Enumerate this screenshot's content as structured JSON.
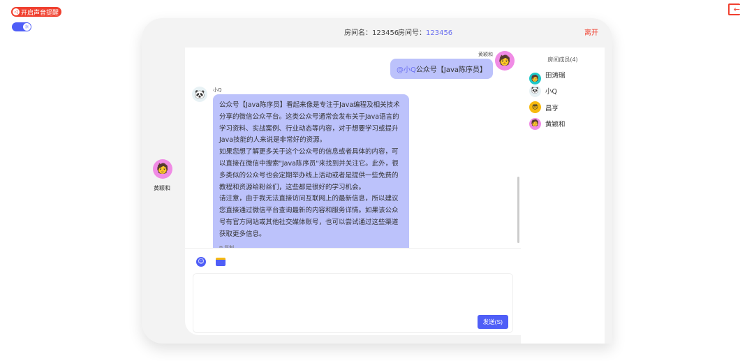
{
  "top": {
    "sound_label": "开启声音提醒",
    "sound_icon": "speaker-icon",
    "toggle_icon": "sun-icon",
    "exit_icon": "exit-icon"
  },
  "header": {
    "room_name_label": "房间名：",
    "room_name": "123456",
    "room_id_label": "房间号：",
    "room_id": "123456",
    "leave": "离开"
  },
  "current_user": {
    "name": "黄颖和"
  },
  "messages": [
    {
      "sender": "黄颖和",
      "mention": "@小Q",
      "text": "公众号【Java陈序员】"
    },
    {
      "sender": "小Q",
      "paragraphs": [
        "公众号【Java陈序员】看起来像是专注于Java编程及相关技术分享的微信公众平台。这类公众号通常会发布关于Java语言的学习资料、实战案例、行业动态等内容，对于想要学习或提升Java技能的人来说是非常好的资源。",
        "如果您想了解更多关于这个公众号的信息或者具体的内容，可以直接在微信中搜索\"Java陈序员\"来找到并关注它。此外，很多类似的公众号也会定期举办线上活动或者是提供一些免费的教程和资源给粉丝们，这些都是很好的学习机会。",
        "请注意，由于我无法直接访问互联网上的最新信息，所以建议您直接通过微信平台查询最新的内容和服务详情。如果该公众号有官方网站或其他社交媒体账号，也可以尝试通过这些渠道获取更多信息。"
      ],
      "copy": "复制"
    }
  ],
  "composer": {
    "send": "发送(S)",
    "input_value": ""
  },
  "members": {
    "title": "房间成员(4)",
    "list": [
      {
        "name": "田涛瑞"
      },
      {
        "name": "小Q"
      },
      {
        "name": "昌亨"
      },
      {
        "name": "黄颖和"
      }
    ]
  },
  "colors": {
    "accent": "#4f5ef7",
    "bubble": "#bcc2fb",
    "danger": "#f0402f"
  }
}
